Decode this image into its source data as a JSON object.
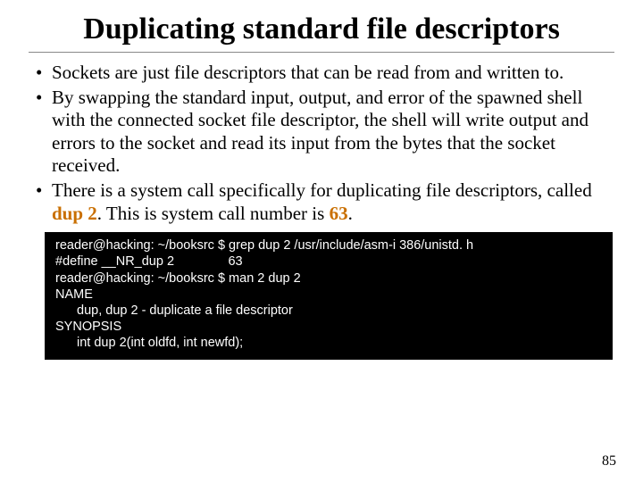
{
  "title": "Duplicating standard file descriptors",
  "bullets": [
    {
      "pre": "Sockets are just file descriptors that can be read from and written to.",
      "hl": "",
      "post": ""
    },
    {
      "pre": "By swapping the standard input, output, and error of the spawned shell with the connected socket file descriptor, the shell will write output and errors to the socket and read its input from the bytes that the socket received.",
      "hl": "",
      "post": ""
    },
    {
      "pre": "There is a system call specifically for duplicating file descriptors, called ",
      "hl": "dup 2",
      "post": ". This is system call number is ",
      "hl2": "63",
      "post2": "."
    }
  ],
  "terminal": {
    "l1": "reader@hacking: ~/booksrc $ grep dup 2 /usr/include/asm-i 386/unistd. h",
    "l2": "#define __NR_dup 2               63",
    "l3": "reader@hacking: ~/booksrc $ man 2 dup 2",
    "l4": "NAME",
    "l5": "dup, dup 2 - duplicate a file descriptor",
    "l6": "SYNOPSIS",
    "l7": "int dup 2(int oldfd, int newfd);"
  },
  "pagenum": "85"
}
